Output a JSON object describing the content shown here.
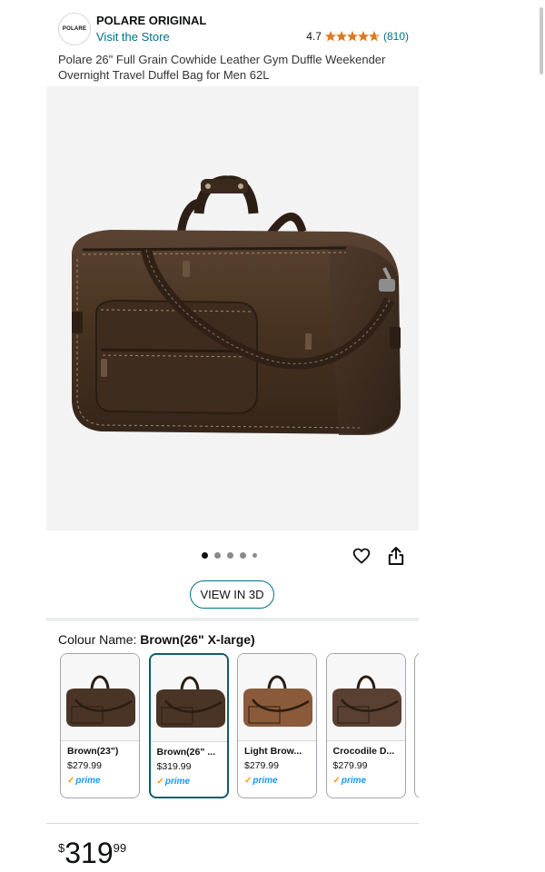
{
  "brand": {
    "logo_text": "POLARE",
    "name": "POLARE ORIGINAL",
    "store_link": "Visit the Store",
    "rating": "4.7",
    "stars": 4.7,
    "review_count": "(810)"
  },
  "product": {
    "title": "Polare 26\" Full Grain Cowhide Leather Gym Duffle Weekender Overnight Travel Duffel Bag for Men 62L"
  },
  "gallery": {
    "total_images": 5,
    "active_index": 0,
    "view_3d_label": "VIEW IN 3D"
  },
  "colour": {
    "label": "Colour Name:",
    "selected": "Brown(26\" X-large)",
    "options": [
      {
        "name": "Brown(23\")",
        "price": "$279.99",
        "prime": "prime",
        "selected": false,
        "tone": "#4a3426"
      },
      {
        "name": "Brown(26\" ...",
        "price": "$319.99",
        "prime": "prime",
        "selected": true,
        "tone": "#4a3426"
      },
      {
        "name": "Light Brow...",
        "price": "$279.99",
        "prime": "prime",
        "selected": false,
        "tone": "#8a5a3a"
      },
      {
        "name": "Crocodile D...",
        "price": "$279.99",
        "prime": "prime",
        "selected": false,
        "tone": "#5a4032"
      }
    ]
  },
  "price": {
    "currency": "$",
    "whole": "319",
    "fraction": "99"
  },
  "colors": {
    "link": "#007185",
    "star": "#de7921",
    "prime": "#1399ff",
    "selected_border": "#0f5d6b"
  }
}
